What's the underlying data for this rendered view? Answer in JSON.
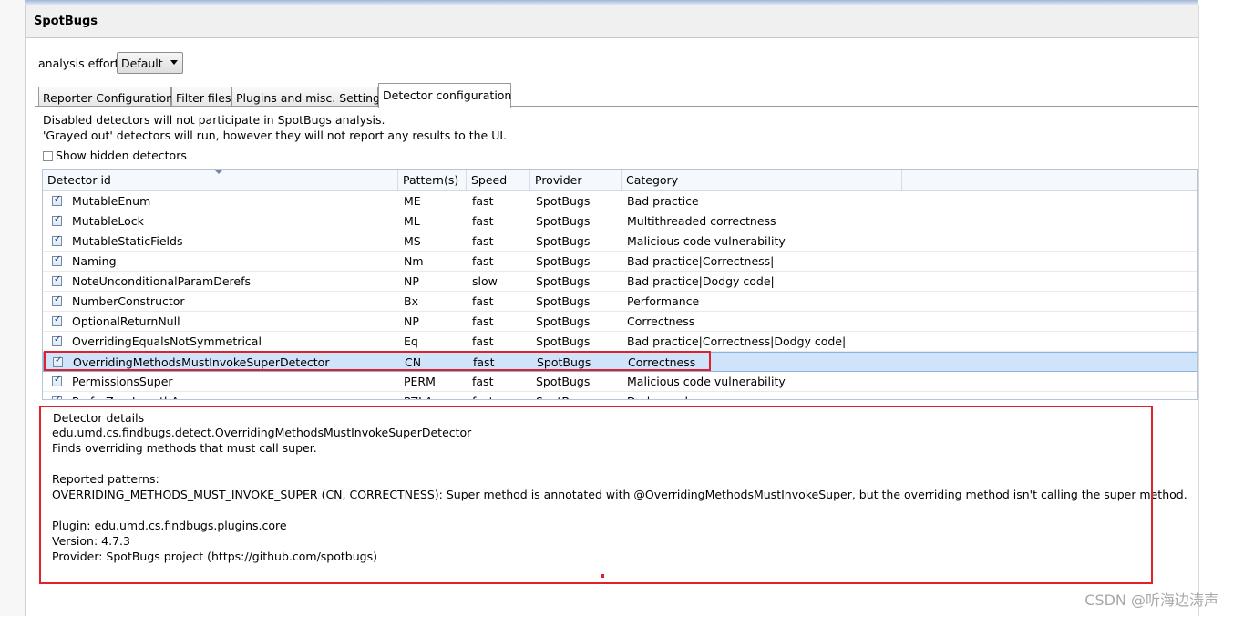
{
  "window": {
    "title": "SpotBugs"
  },
  "analysis_effort": {
    "label": "analysis effort",
    "value": "Default"
  },
  "tabs": [
    {
      "label": "Reporter Configuration"
    },
    {
      "label": "Filter files"
    },
    {
      "label": "Plugins and misc. Settings"
    },
    {
      "label": "Detector configuration"
    }
  ],
  "info": {
    "line1": "Disabled detectors will not participate in SpotBugs analysis.",
    "line2": "'Grayed out' detectors will run, however they will not report any results to the UI."
  },
  "show_hidden": {
    "label": "Show hidden detectors",
    "checked": false
  },
  "table": {
    "columns": [
      "Detector id",
      "Pattern(s)",
      "Speed",
      "Provider",
      "Category"
    ],
    "rows": [
      {
        "id": "MutableEnum",
        "pattern": "ME",
        "speed": "fast",
        "provider": "SpotBugs",
        "category": "Bad practice"
      },
      {
        "id": "MutableLock",
        "pattern": "ML",
        "speed": "fast",
        "provider": "SpotBugs",
        "category": "Multithreaded correctness"
      },
      {
        "id": "MutableStaticFields",
        "pattern": "MS",
        "speed": "fast",
        "provider": "SpotBugs",
        "category": "Malicious code vulnerability"
      },
      {
        "id": "Naming",
        "pattern": "Nm",
        "speed": "fast",
        "provider": "SpotBugs",
        "category": "Bad practice|Correctness|"
      },
      {
        "id": "NoteUnconditionalParamDerefs",
        "pattern": "NP",
        "speed": "slow",
        "provider": "SpotBugs",
        "category": "Bad practice|Dodgy code|"
      },
      {
        "id": "NumberConstructor",
        "pattern": "Bx",
        "speed": "fast",
        "provider": "SpotBugs",
        "category": "Performance"
      },
      {
        "id": "OptionalReturnNull",
        "pattern": "NP",
        "speed": "fast",
        "provider": "SpotBugs",
        "category": "Correctness"
      },
      {
        "id": "OverridingEqualsNotSymmetrical",
        "pattern": "Eq",
        "speed": "fast",
        "provider": "SpotBugs",
        "category": "Bad practice|Correctness|Dodgy code|"
      },
      {
        "id": "OverridingMethodsMustInvokeSuperDetector",
        "pattern": "CN",
        "speed": "fast",
        "provider": "SpotBugs",
        "category": "Correctness"
      },
      {
        "id": "PermissionsSuper",
        "pattern": "PERM",
        "speed": "fast",
        "provider": "SpotBugs",
        "category": "Malicious code vulnerability"
      },
      {
        "id": "PreferZeroLengthArrays",
        "pattern": "PZLA",
        "speed": "fast",
        "provider": "SpotBugs",
        "category": "Dodgy code"
      }
    ]
  },
  "details": {
    "title": "Detector details",
    "class_name": "edu.umd.cs.findbugs.detect.OverridingMethodsMustInvokeSuperDetector",
    "description": "Finds overriding methods that must call super.",
    "patterns_heading": "Reported patterns:",
    "pattern_line": "OVERRIDING_METHODS_MUST_INVOKE_SUPER  (CN, CORRECTNESS):  Super method is annotated with @OverridingMethodsMustInvokeSuper, but the overriding method isn't calling the super method.",
    "plugin": "Plugin: edu.umd.cs.findbugs.plugins.core",
    "version": "Version: 4.7.3",
    "provider": "Provider: SpotBugs project (https://github.com/spotbugs)"
  },
  "watermark": "CSDN @听海边涛声",
  "colors": {
    "highlight": "#e0202a",
    "selection": "#cfe3fb"
  }
}
